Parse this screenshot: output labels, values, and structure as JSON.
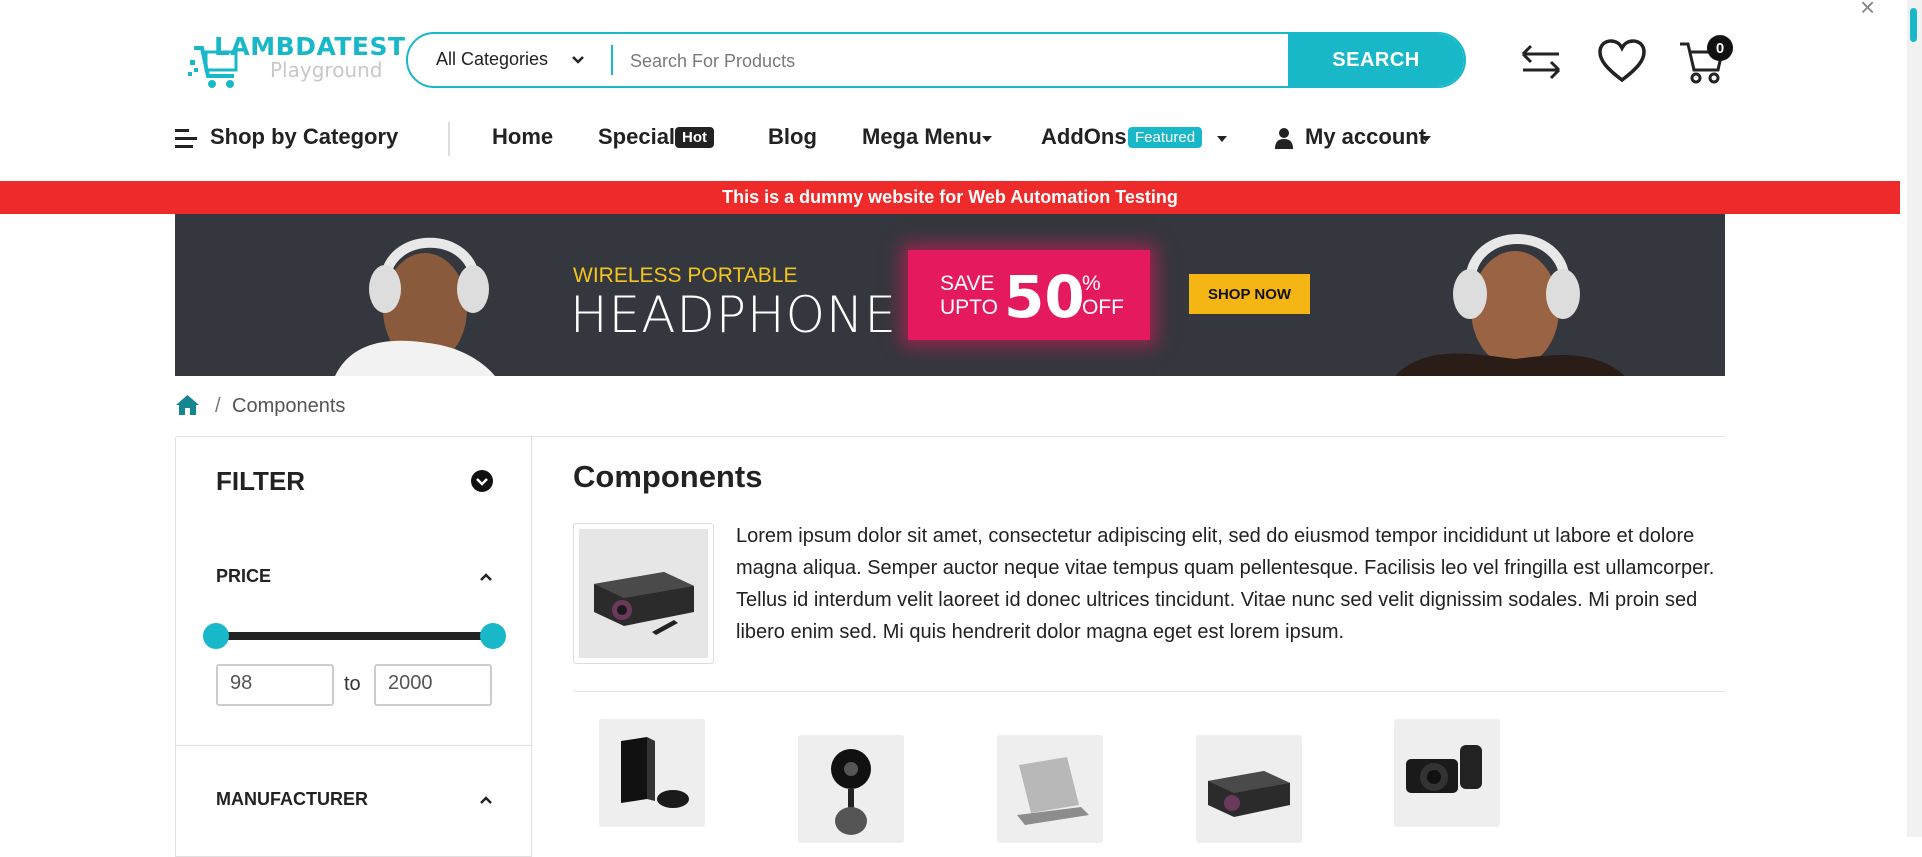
{
  "logo": {
    "title": "LAMBDATEST",
    "subtitle": "Playground"
  },
  "search": {
    "category": "All Categories",
    "placeholder": "Search For Products",
    "button": "SEARCH"
  },
  "header_icons": {
    "compare": "compare-arrows-icon",
    "wishlist": "heart-icon",
    "cart": "cart-icon",
    "cart_count": "0"
  },
  "nav": {
    "shop_by_category": "Shop by Category",
    "home": "Home",
    "special": "Special",
    "special_tag": "Hot",
    "blog": "Blog",
    "mega_menu": "Mega Menu",
    "addons": "AddOns",
    "addons_tag": "Featured",
    "my_account": "My account"
  },
  "notice": "This is a dummy website for Web Automation Testing",
  "promo": {
    "subtitle": "WIRELESS PORTABLE",
    "title": "HEADPHONE",
    "save": "SAVE",
    "upto": "UPTO",
    "amount": "50",
    "percent": "%",
    "off": "OFF",
    "cta": "SHOP NOW"
  },
  "breadcrumb": {
    "separator": "/",
    "current": "Components"
  },
  "filter": {
    "title": "FILTER",
    "price_title": "PRICE",
    "price_min": "98",
    "price_max": "2000",
    "to": "to",
    "manufacturer_title": "MANUFACTURER"
  },
  "main": {
    "title": "Components",
    "description": "Lorem ipsum dolor sit amet, consectetur adipiscing elit, sed do eiusmod tempor incididunt ut labore et dolore magna aliqua. Semper auctor neque vitae tempus quam pellentesque. Facilisis leo vel fringilla est ullamcorper. Tellus id interdum velit laoreet id donec ultrices tincidunt. Vitae nunc sed velit dignissim sodales. Mi proin sed libero enim sed. Mi quis hendrerit dolor magna eget est lorem ipsum."
  },
  "products": [
    "game-console",
    "security-camera",
    "laptop",
    "projector",
    "dslr-camera"
  ],
  "colors": {
    "accent": "#19b8c8",
    "notice": "#ee2a2a",
    "promo_bg": "#34373d",
    "save": "#e5195e",
    "cta": "#f5b614"
  }
}
